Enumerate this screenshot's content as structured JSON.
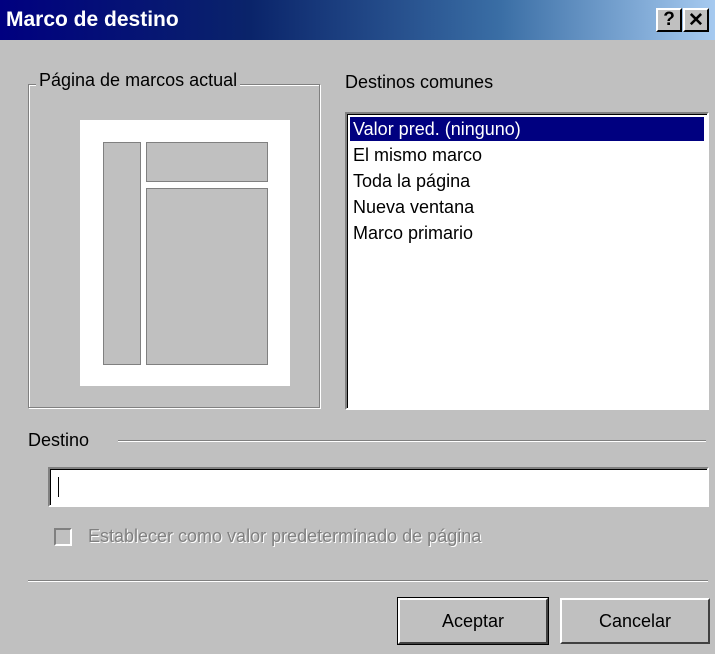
{
  "window": {
    "title": "Marco de destino",
    "help_label": "?",
    "close_label": "✕"
  },
  "frames_group": {
    "label": "Página de marcos actual"
  },
  "common_targets": {
    "label": "Destinos comunes",
    "items": [
      "Valor pred. (ninguno)",
      "El mismo marco",
      "Toda la página",
      "Nueva ventana",
      "Marco primario"
    ],
    "selected_index": 0
  },
  "target": {
    "label": "Destino",
    "value": ""
  },
  "default_checkbox": {
    "label": "Establecer como valor predeterminado de página",
    "checked": false,
    "enabled": false
  },
  "buttons": {
    "ok": "Aceptar",
    "cancel": "Cancelar"
  },
  "colors": {
    "titlebar_start": "#000080",
    "selection": "#000080",
    "dialog_bg": "#c0c0c0"
  }
}
